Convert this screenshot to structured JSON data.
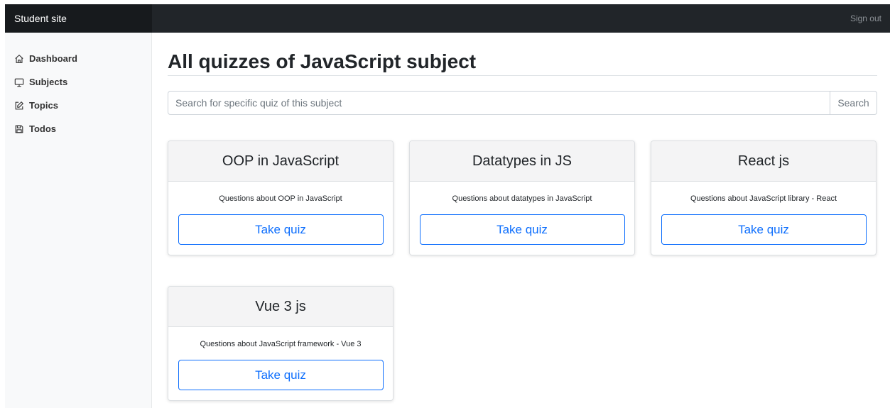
{
  "navbar": {
    "brand": "Student site",
    "sign_out": "Sign out"
  },
  "sidebar": {
    "items": [
      {
        "label": "Dashboard",
        "icon": "home-icon"
      },
      {
        "label": "Subjects",
        "icon": "monitor-icon"
      },
      {
        "label": "Topics",
        "icon": "edit-icon"
      },
      {
        "label": "Todos",
        "icon": "save-icon"
      }
    ]
  },
  "main": {
    "title": "All quizzes of JavaScript subject",
    "search": {
      "placeholder": "Search for specific quiz of this subject",
      "value": "",
      "button": "Search"
    },
    "quizzes": [
      {
        "title": "OOP in JavaScript",
        "description": "Questions about OOP in JavaScript",
        "button": "Take quiz"
      },
      {
        "title": "Datatypes in JS",
        "description": "Questions about datatypes in JavaScript",
        "button": "Take quiz"
      },
      {
        "title": "React js",
        "description": "Questions about JavaScript library - React",
        "button": "Take quiz"
      },
      {
        "title": "Vue 3 js",
        "description": "Questions about JavaScript framework - Vue 3",
        "button": "Take quiz"
      }
    ]
  },
  "colors": {
    "navbar": "#212529",
    "brand_bg": "#171a1d",
    "accent": "#0d6efd",
    "sidebar": "#f8f9fa"
  }
}
